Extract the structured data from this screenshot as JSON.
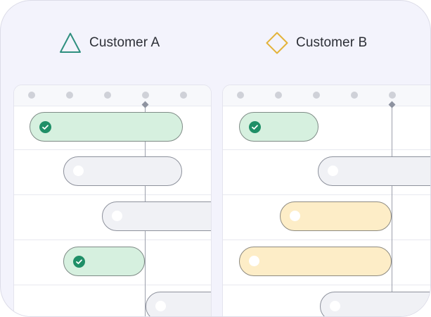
{
  "customers": [
    {
      "label": "Customer A",
      "icon": "triangle-icon",
      "accent": "#2f8f7f"
    },
    {
      "label": "Customer B",
      "icon": "diamond-icon",
      "accent": "#e3b33a"
    }
  ],
  "task_status_colors": {
    "completed": "#d6f0df",
    "pending": "#f0f1f5",
    "in_progress": "#fdedc7",
    "check": "#1f8f67"
  }
}
